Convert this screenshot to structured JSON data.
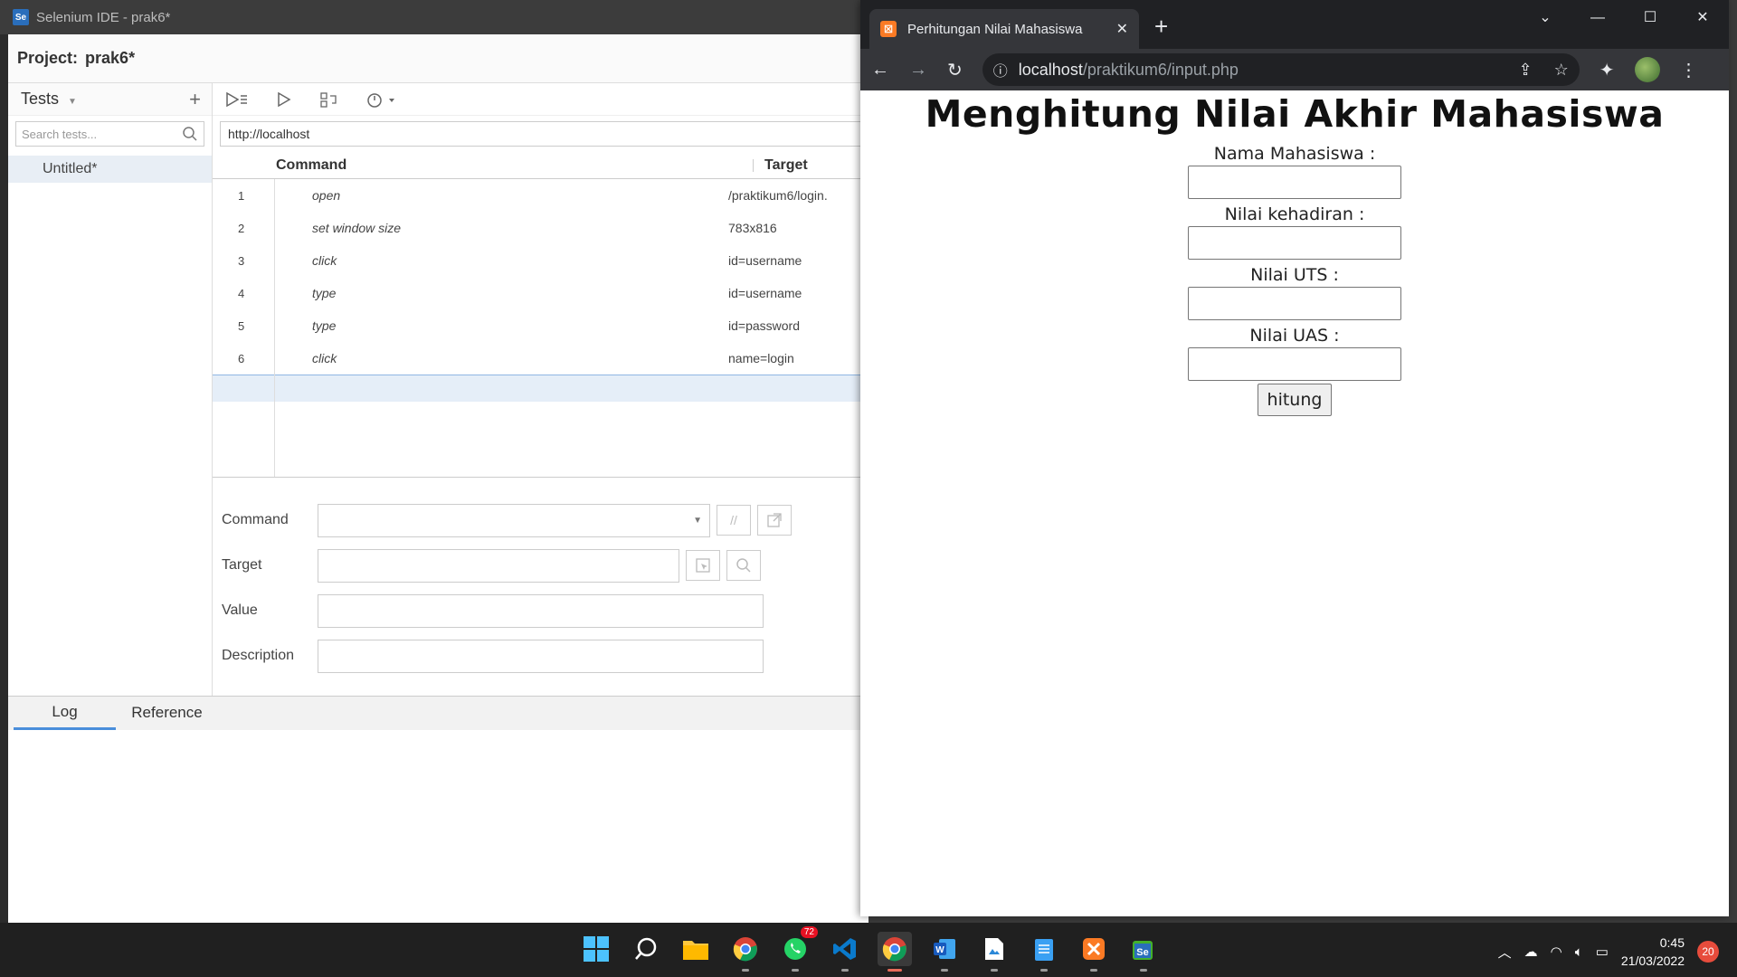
{
  "ide": {
    "window_title": "Selenium IDE - prak6*",
    "logo": "Se",
    "project_label": "Project:",
    "project_name": "prak6*",
    "tests_label": "Tests",
    "search_placeholder": "Search tests...",
    "test_items": [
      "Untitled*"
    ],
    "base_url": "http://localhost",
    "columns": {
      "command": "Command",
      "target": "Target"
    },
    "commands": [
      {
        "n": "1",
        "command": "open",
        "target": "/praktikum6/login."
      },
      {
        "n": "2",
        "command": "set window size",
        "target": "783x816"
      },
      {
        "n": "3",
        "command": "click",
        "target": "id=username"
      },
      {
        "n": "4",
        "command": "type",
        "target": "id=username"
      },
      {
        "n": "5",
        "command": "type",
        "target": "id=password"
      },
      {
        "n": "6",
        "command": "click",
        "target": "name=login"
      }
    ],
    "props": {
      "command": "Command",
      "target": "Target",
      "value": "Value",
      "description": "Description"
    },
    "bottom_tabs": {
      "log": "Log",
      "reference": "Reference"
    }
  },
  "chrome": {
    "tab_title": "Perhitungan Nilai Mahasiswa",
    "url_host": "localhost",
    "url_path": "/praktikum6/input.php"
  },
  "page": {
    "heading": "Menghitung Nilai Akhir Mahasiswa",
    "labels": [
      "Nama Mahasiswa :",
      "Nilai kehadiran :",
      "Nilai UTS :",
      "Nilai UAS :"
    ],
    "button": "hitung"
  },
  "taskbar": {
    "whatsapp_badge": "72",
    "time": "0:45",
    "date": "21/03/2022",
    "notifications": "20"
  }
}
